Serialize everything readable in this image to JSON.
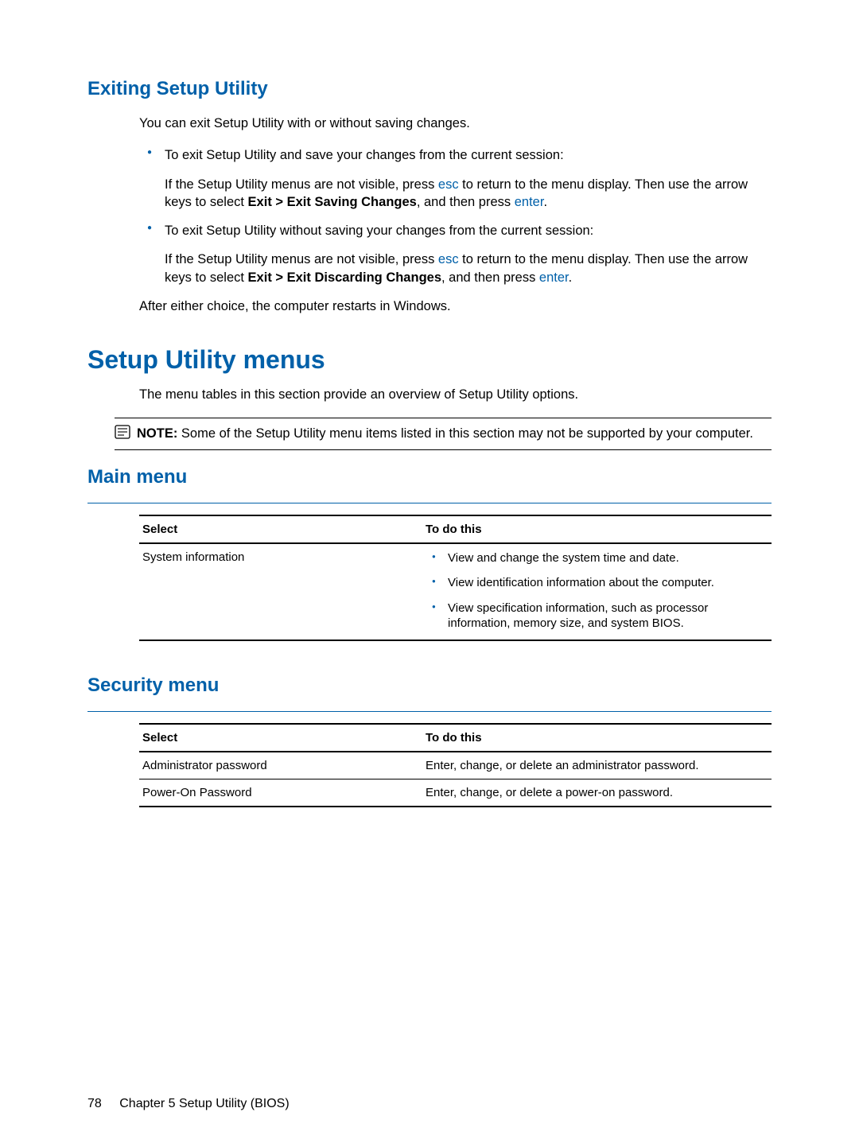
{
  "sections": {
    "exit": {
      "title": "Exiting Setup Utility",
      "intro": "You can exit Setup Utility with or without saving changes.",
      "bullet1_lead": "To exit Setup Utility and save your changes from the current session:",
      "bullet1_body_pre": "If the Setup Utility menus are not visible, press ",
      "bullet1_key1": "esc",
      "bullet1_body_mid": " to return to the menu display. Then use the arrow keys to select ",
      "bullet1_bold": "Exit > Exit Saving Changes",
      "bullet1_body_post": ", and then press ",
      "bullet1_key2": "enter",
      "bullet1_tail": ".",
      "bullet2_lead": "To exit Setup Utility without saving your changes from the current session:",
      "bullet2_body_pre": "If the Setup Utility menus are not visible, press ",
      "bullet2_key1": "esc",
      "bullet2_body_mid": " to return to the menu display. Then use the arrow keys to select ",
      "bullet2_bold": "Exit > Exit Discarding Changes",
      "bullet2_body_post": ", and then press ",
      "bullet2_key2": "enter",
      "bullet2_tail": ".",
      "after": "After either choice, the computer restarts in Windows."
    },
    "menus": {
      "title": "Setup Utility menus",
      "intro": "The menu tables in this section provide an overview of Setup Utility options.",
      "note_label": "NOTE:",
      "note_body": "   Some of the Setup Utility menu items listed in this section may not be supported by your computer."
    },
    "main_menu": {
      "title": "Main menu",
      "headers": {
        "select": "Select",
        "action": "To do this"
      },
      "row1_select": "System information",
      "row1_items": [
        "View and change the system time and date.",
        "View identification information about the computer.",
        "View specification information, such as processor information, memory size, and system BIOS."
      ]
    },
    "security_menu": {
      "title": "Security menu",
      "headers": {
        "select": "Select",
        "action": "To do this"
      },
      "rows": [
        {
          "select": "Administrator password",
          "action": "Enter, change, or delete an administrator password."
        },
        {
          "select": "Power-On Password",
          "action": "Enter, change, or delete a power-on password."
        }
      ]
    }
  },
  "footer": {
    "page": "78",
    "chapter": "Chapter 5   Setup Utility (BIOS)"
  }
}
